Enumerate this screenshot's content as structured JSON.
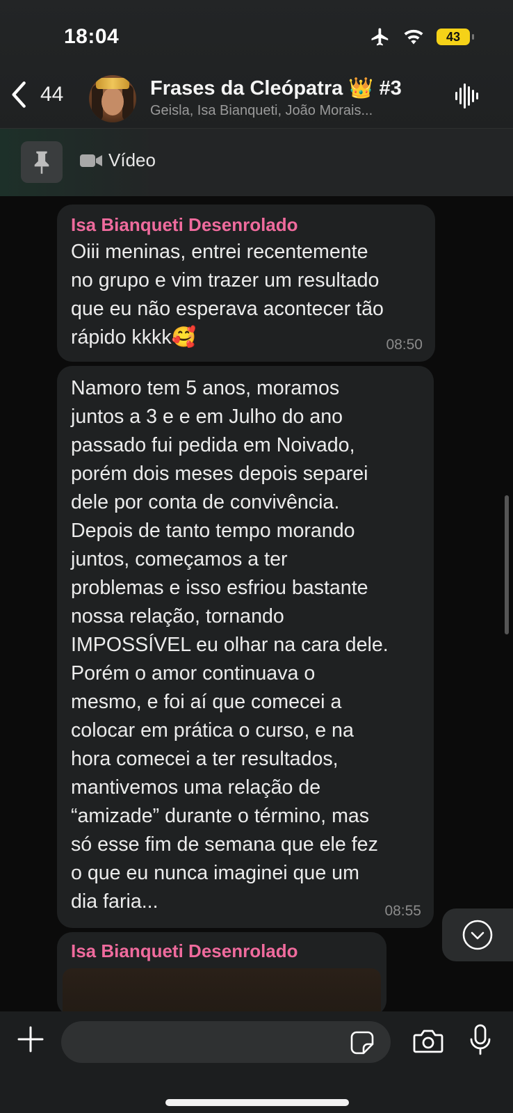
{
  "status_bar": {
    "time": "18:04",
    "battery": "43",
    "icons": [
      "airplane-icon",
      "wifi-icon",
      "battery-icon"
    ]
  },
  "chat_header": {
    "back_count": "44",
    "title": "Frases da Cleópatra 👑 #3",
    "subtitle": "Geisla, Isa Bianqueti, João Morais..."
  },
  "pinned": {
    "label": "Vídeo"
  },
  "messages": [
    {
      "sender": "Isa Bianqueti Desenrolado",
      "lines": [
        "Oiii meninas, entrei recentemente",
        "no grupo e vim trazer um resultado",
        "que eu não esperava acontecer tão",
        "rápido kkkk🥰"
      ],
      "time": "08:50"
    },
    {
      "lines": [
        "Namoro tem 5 anos, moramos",
        "juntos a 3 e e em Julho do ano",
        "passado fui pedida em Noivado,",
        "porém dois meses depois separei",
        "dele por conta de convivência.",
        "Depois de tanto tempo morando",
        "juntos, começamos a ter",
        "problemas e isso esfriou bastante",
        "nossa relação, tornando",
        "IMPOSSÍVEL eu olhar na cara dele.",
        "Porém o amor continuava o",
        "mesmo, e foi aí que comecei a",
        "colocar em prática o curso, e na",
        "hora comecei a ter resultados,",
        "mantivemos uma relação de",
        "“amizade” durante o término, mas",
        "só esse fim de semana que ele fez",
        "o que eu nunca imaginei que um",
        "dia faria..."
      ],
      "time": "08:55"
    },
    {
      "sender": "Isa Bianqueti Desenrolado"
    }
  ],
  "composer": {
    "placeholder": ""
  },
  "colors": {
    "sender_name": "#ef6b9d",
    "bubble_bg": "#1f2122",
    "chat_bg": "#0b0b0b",
    "battery": "#f5d218"
  }
}
